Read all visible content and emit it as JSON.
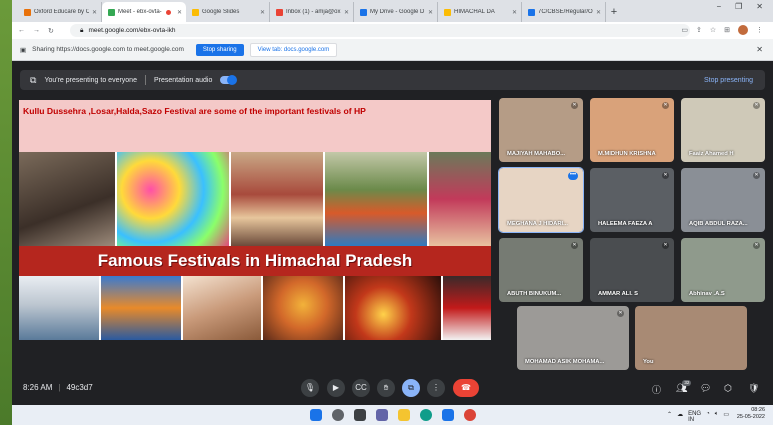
{
  "browser": {
    "tabs": [
      {
        "label": "Oxford Educare by C",
        "color": "#e8710a",
        "active": false
      },
      {
        "label": "Meet - ebx-ovta-",
        "color": "#34a853",
        "active": true
      },
      {
        "label": "Google Slides",
        "color": "#fbbc04",
        "active": false
      },
      {
        "label": "Inbox (1) - amja@ox",
        "color": "#ea4335",
        "active": false
      },
      {
        "label": "My Drive - Google D",
        "color": "#1a73e8",
        "active": false
      },
      {
        "label": "HIMACHAL DA",
        "color": "#fbbc04",
        "active": false
      },
      {
        "label": "7C/CBSE/Regular/Ox",
        "color": "#1a73e8",
        "active": false
      }
    ],
    "new_tab": "+",
    "window_controls": [
      "−",
      "❐",
      "✕"
    ],
    "url": "meet.google.com/ebx-ovta-ikh"
  },
  "share_bar": {
    "message": "Sharing https://docs.google.com to meet.google.com",
    "stop_label": "Stop sharing",
    "view_label": "View tab: docs.google.com",
    "close": "✕"
  },
  "presenting": {
    "message": "You're presenting to everyone",
    "audio_label": "Presentation audio",
    "stop_label": "Stop presenting"
  },
  "slide": {
    "title": "Kullu Dussehra ,Losar,Halda,Sazo Festival are some of the important festivals of HP",
    "banner": "Famous Festivals in Himachal Pradesh"
  },
  "participants": [
    {
      "name": "MAJIYAH MAHABO...",
      "bg": "#b59c86",
      "speaking": false
    },
    {
      "name": "M.MIDHUN KRISHNA",
      "bg": "#d9a27a",
      "speaking": false
    },
    {
      "name": "Faaiz Ahamed H",
      "bg": "#cfc9b8",
      "speaking": false
    },
    {
      "name": "MEGHANA J HIDARI...",
      "bg": "#e7d5c4",
      "speaking": true
    },
    {
      "name": "HALEEMA FAEZA A",
      "bg": "#5b5f64",
      "speaking": false
    },
    {
      "name": "AQIB ABDUL RAZA...",
      "bg": "#8a8f96",
      "speaking": false
    },
    {
      "name": "ABUTH BINUKUM...",
      "bg": "#767b73",
      "speaking": false
    },
    {
      "name": "AMMAR ALI. S",
      "bg": "#4a4d50",
      "speaking": false
    },
    {
      "name": "Abhinav .A.S",
      "bg": "#8f9a8c",
      "speaking": false
    },
    {
      "name": "MOHAMAD ASIK MOHAMA...",
      "bg": "#9c9a97",
      "speaking": false
    },
    {
      "name": "You",
      "bg": "#a88a74",
      "speaking": false
    }
  ],
  "meeting": {
    "time": "8:26 AM",
    "code": "49c3d7",
    "people_count": "32"
  },
  "taskbar": {
    "lang": "ENG",
    "region": "IN",
    "clock": "08:26",
    "date": "25-05-2022"
  }
}
